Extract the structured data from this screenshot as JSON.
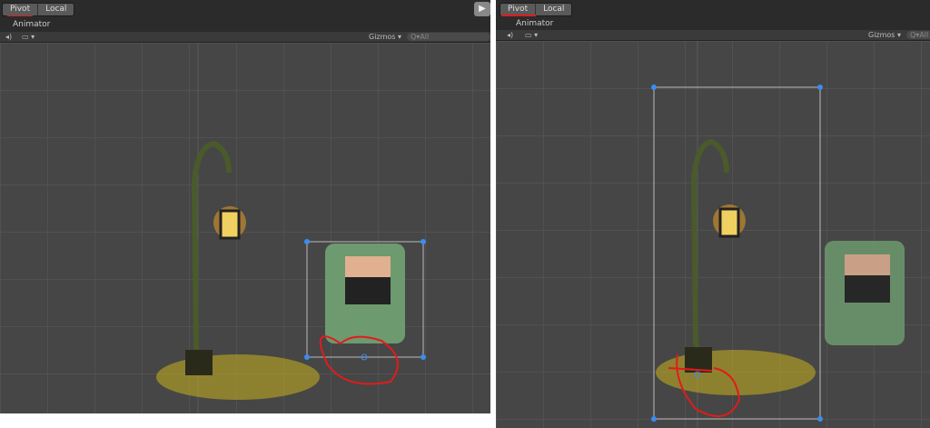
{
  "panels": [
    {
      "toolbar": {
        "pivot": "Pivot",
        "local": "Local"
      },
      "tab": "Animator",
      "scene_toolbar": {
        "gizmos": "Gizmos ▾",
        "search": "Q▾All"
      }
    },
    {
      "toolbar": {
        "pivot": "Pivot",
        "local": "Local"
      },
      "tab": "Animator",
      "scene_toolbar": {
        "gizmos": "Gizmos ▾",
        "search": "Q▾All"
      }
    }
  ],
  "colors": {
    "annotation": "#e21b1b",
    "handle": "#3c8cf0",
    "background": "#474747"
  }
}
